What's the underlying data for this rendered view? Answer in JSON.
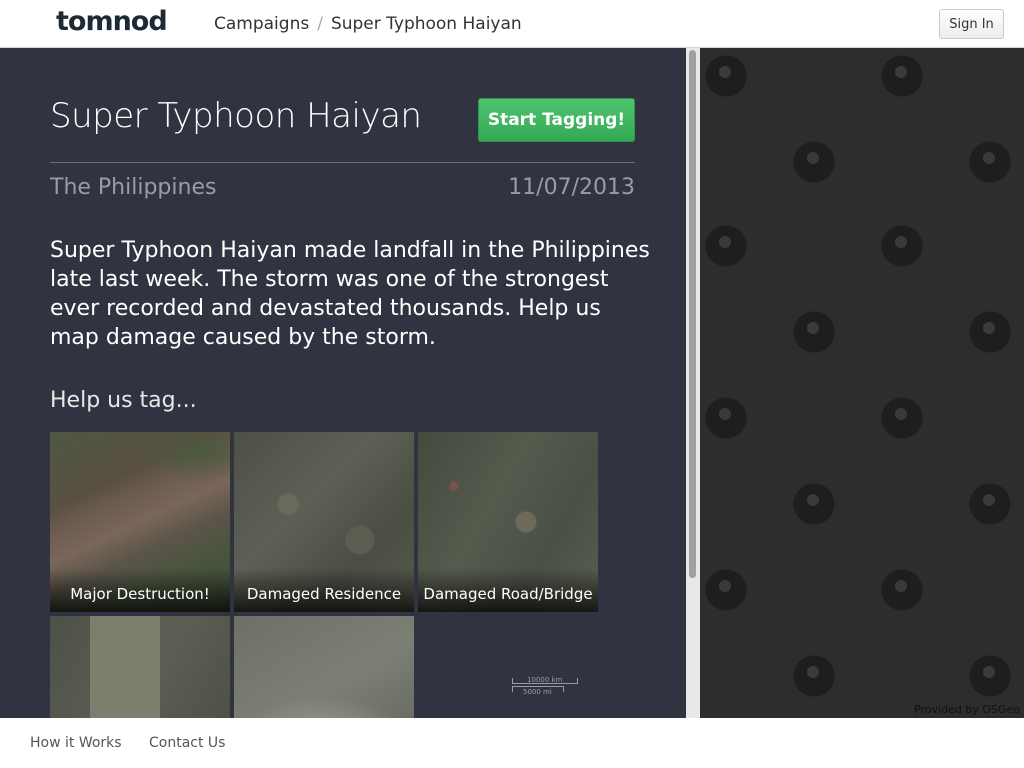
{
  "header": {
    "logo_text": "tomnod",
    "breadcrumb": [
      "Campaigns",
      "Super Typhoon Haiyan"
    ],
    "breadcrumb_separator": "/",
    "signin_label": "Sign In"
  },
  "campaign": {
    "title": "Super Typhoon Haiyan",
    "start_label": "Start Tagging!",
    "location": "The Philippines",
    "date": "11/07/2013",
    "description": "Super Typhoon Haiyan made landfall in the Philippines late last week. The storm was one of the strongest ever recorded and devastated thousands. Help us map damage caused by the storm.",
    "help_heading": "Help us tag...",
    "tags": [
      {
        "label": "Major Destruction!"
      },
      {
        "label": "Damaged Residence"
      },
      {
        "label": "Damaged Road/Bridge"
      },
      {
        "label": ""
      },
      {
        "label": ""
      }
    ],
    "scale": {
      "top": "10000 km",
      "bottom": "5000 mi"
    }
  },
  "map": {
    "attribution": "Provided by OSGeo"
  },
  "footer": {
    "links": [
      "How it Works",
      "Contact Us"
    ]
  },
  "colors": {
    "panel_bg": "#313440",
    "accent_green": "#3bb05a",
    "map_bg": "#2d2d2d"
  }
}
